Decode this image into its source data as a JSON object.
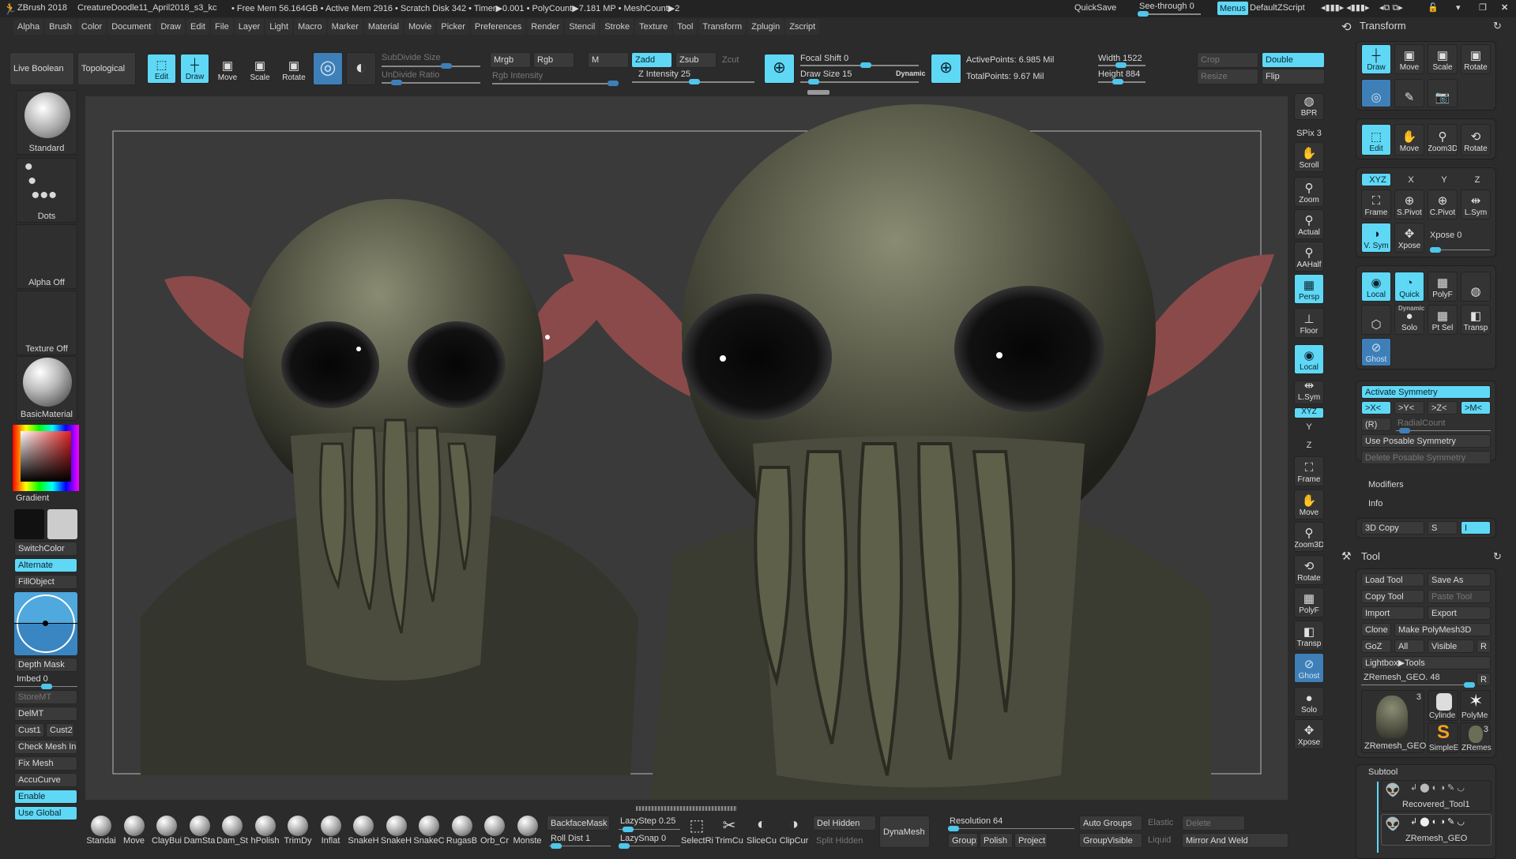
{
  "titlebar": {
    "app": "ZBrush 2018",
    "file": "CreatureDoodle11_April2018_s3_kc",
    "stats": "• Free Mem 56.164GB • Active Mem 2916 • Scratch Disk 342 • Timer▶0.001 • PolyCount▶7.181 MP • MeshCount▶2",
    "quicksave": "QuickSave",
    "seethrough": "See-through  0",
    "menus": "Menus",
    "script": "DefaultZScript"
  },
  "menu": [
    "Alpha",
    "Brush",
    "Color",
    "Document",
    "Draw",
    "Edit",
    "File",
    "Layer",
    "Light",
    "Macro",
    "Marker",
    "Material",
    "Movie",
    "Picker",
    "Preferences",
    "Render",
    "Stencil",
    "Stroke",
    "Texture",
    "Tool",
    "Transform",
    "Zplugin",
    "Zscript"
  ],
  "topshelf": {
    "live_boolean": "Live Boolean",
    "topological": "Topological",
    "edit": "Edit",
    "draw": "Draw",
    "move": "Move",
    "scale": "Scale",
    "rotate": "Rotate",
    "subdivide_size": "SubDivide Size",
    "undivide_ratio": "UnDivide Ratio",
    "mrgb": "Mrgb",
    "rgb": "Rgb",
    "m": "M",
    "zadd": "Zadd",
    "zsub": "Zsub",
    "zcut": "Zcut",
    "rgb_intensity": "Rgb Intensity",
    "z_intensity": "Z Intensity 25",
    "focal_shift": "Focal Shift 0",
    "draw_size": "Draw Size 15",
    "dynamic": "Dynamic",
    "active_points": "ActivePoints: 6.985 Mil",
    "total_points": "TotalPoints: 9.67 Mil",
    "width": "Width 1522",
    "height": "Height 884",
    "crop": "Crop",
    "resize": "Resize",
    "double": "Double",
    "flip": "Flip"
  },
  "leftshelf": {
    "brush": "Standard",
    "stroke": "Dots",
    "alpha": "Alpha Off",
    "texture": "Texture Off",
    "material": "BasicMaterial",
    "gradient": "Gradient",
    "switchcolor": "SwitchColor",
    "alternate": "Alternate",
    "fillobject": "FillObject",
    "depth_mask": "Depth Mask",
    "imbed": "Imbed 0",
    "storemt": "StoreMT",
    "delmt": "DelMT",
    "cust1": "Cust1",
    "cust2": "Cust2",
    "check_mesh": "Check Mesh In",
    "fix_mesh": "Fix Mesh",
    "accucurve": "AccuCurve",
    "enable": "Enable",
    "use_global": "Use Global"
  },
  "rightbar": [
    "BPR",
    "SPix 3",
    "Scroll",
    "Zoom",
    "Actual",
    "AAHalf",
    "Persp",
    "Floor",
    "Local",
    "L.Sym",
    "XYZ",
    "Y",
    "Z",
    "Frame",
    "Move",
    "Zoom3D",
    "Rotate",
    "PolyF",
    "Transp",
    "Ghost",
    "Solo",
    "Xpose"
  ],
  "rightbar_extra": {
    "dynamic": "Dynamic"
  },
  "transform": {
    "title": "Transform",
    "row1": [
      "Draw",
      "Move",
      "Scale",
      "Rotate"
    ],
    "row2": [
      "Edit",
      "Move",
      "Zoom3D",
      "Rotate"
    ],
    "axes": [
      "XYZ",
      "X",
      "Y",
      "Z"
    ],
    "row3": [
      "Frame",
      "S.Pivot",
      "C.Pivot",
      "L.Sym"
    ],
    "vsym": "V. Sym",
    "xpose": "Xpose",
    "xpose_val": "Xpose 0",
    "row4": [
      "Local",
      "Quick",
      "PolyF",
      ""
    ],
    "row5": [
      "",
      "Solo",
      "Pt Sel",
      "Transp"
    ],
    "ghost": "Ghost",
    "dynamic": "Dynamic",
    "activate_symmetry": "Activate Symmetry",
    "sym": [
      ">X<",
      ">Y<",
      ">Z<",
      ">M<"
    ],
    "r": "(R)",
    "radialcount": "RadialCount",
    "use_posable": "Use Posable Symmetry",
    "delete_posable": "Delete Posable Symmetry",
    "modifiers": "Modifiers",
    "info": "Info",
    "copy3d": "3D Copy",
    "s": "S",
    "i": "I"
  },
  "tool": {
    "title": "Tool",
    "load": "Load Tool",
    "saveas": "Save As",
    "copy": "Copy Tool",
    "paste": "Paste Tool",
    "import": "Import",
    "export": "Export",
    "clone": "Clone",
    "make_polymesh": "Make PolyMesh3D",
    "goz": "GoZ",
    "all": "All",
    "visible": "Visible",
    "r": "R",
    "lightbox": "Lightbox▶Tools",
    "current": "ZRemesh_GEO. 48",
    "thumbs": [
      "ZRemesh_GEO",
      "Cylinde",
      "PolyMe",
      "SimpleE",
      "ZRemes"
    ],
    "count": "3",
    "subtool": "Subtool",
    "subtools": [
      "Recovered_Tool1",
      "ZRemesh_GEO"
    ]
  },
  "bottom": {
    "brushes": [
      "Standai",
      "Move",
      "ClayBui",
      "DamSta",
      "Dam_St",
      "hPolish",
      "TrimDy",
      "Inflat",
      "SnakeH",
      "SnakeH",
      "SnakeC",
      "RugasB",
      "Orb_Cr",
      "Monste"
    ],
    "backface": "BackfaceMask",
    "rolldist": "Roll Dist 1",
    "lazystep": "LazyStep 0.25",
    "lazysnap": "LazySnap 0",
    "tools": [
      "SelectRi",
      "TrimCu",
      "SliceCu",
      "ClipCur"
    ],
    "del_hidden": "Del Hidden",
    "split_hidden": "Split Hidden",
    "dynamesh": "DynaMesh",
    "resolution": "Resolution 64",
    "groups": "Group:",
    "polish": "Polish",
    "project": "Project",
    "auto_groups": "Auto Groups",
    "elastic": "Elastic",
    "delete": "Delete",
    "groupvisible": "GroupVisible",
    "liquid": "Liquid",
    "mirror_weld": "Mirror And Weld"
  },
  "colors": {
    "accent": "#5fd8f5",
    "blue": "#3f7fb8",
    "bg": "#2b2b2b",
    "canvas": "#3a3a3a"
  }
}
